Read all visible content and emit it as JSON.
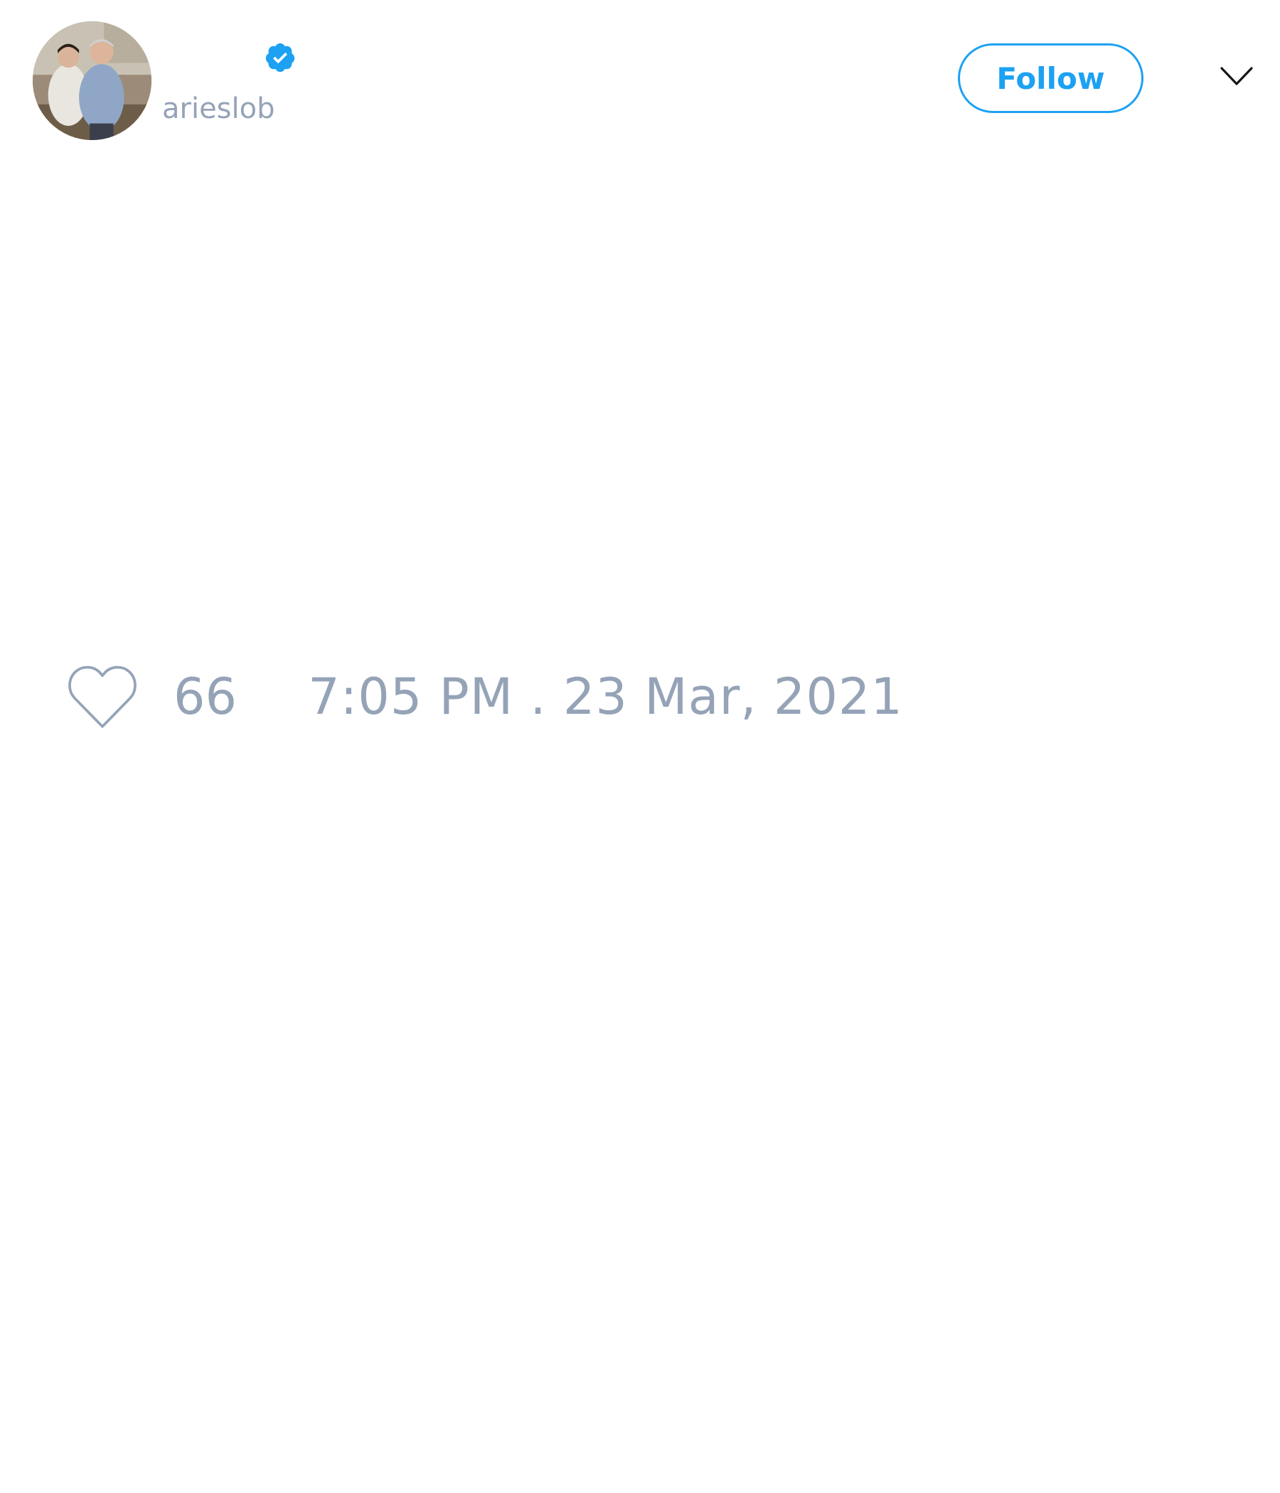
{
  "user": {
    "handle": "arieslob",
    "verified": true,
    "avatar_icon": "profile-photo"
  },
  "header": {
    "follow_label": "Follow",
    "menu_icon": "chevron-down-icon"
  },
  "engagement": {
    "like_icon": "heart-outline-icon",
    "like_count": "66",
    "timestamp": "7:05 PM . 23 Mar, 2021"
  },
  "colors": {
    "accent": "#1da1f2",
    "muted_text": "#95a3b7",
    "background": "#ffffff"
  }
}
